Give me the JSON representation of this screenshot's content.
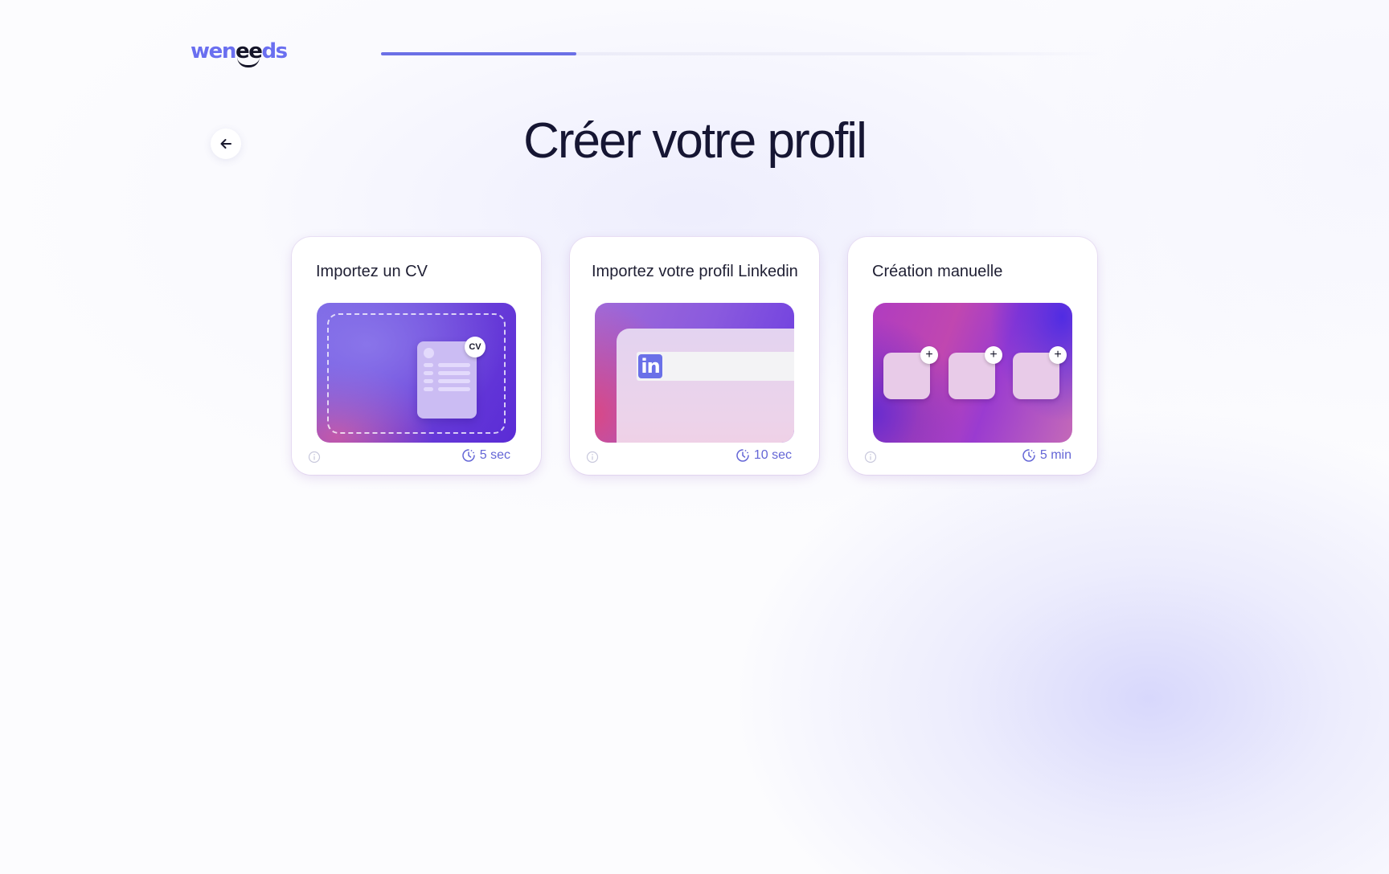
{
  "brand": {
    "logo_parts": [
      "wen",
      "ee",
      "ds"
    ],
    "logo_text": "weneeds",
    "accent_color": "#6b70e6"
  },
  "progress": {
    "value": 0.27
  },
  "header": {
    "back_icon": "arrow-left-icon",
    "title": "Créer votre profil"
  },
  "cards": [
    {
      "title": "Importez un CV",
      "duration": "5 sec",
      "illustration": "cv-upload-illustration",
      "badge": "CV",
      "icons": [
        "info-icon",
        "timer-icon"
      ]
    },
    {
      "title": "Importez votre profil Linkedin",
      "duration": "10 sec",
      "illustration": "linkedin-import-illustration",
      "badge": "in",
      "icons": [
        "info-icon",
        "timer-icon"
      ]
    },
    {
      "title": "Création manuelle",
      "duration": "5 min",
      "illustration": "manual-creation-illustration",
      "badge": "+",
      "icons": [
        "info-icon",
        "timer-icon"
      ]
    }
  ]
}
